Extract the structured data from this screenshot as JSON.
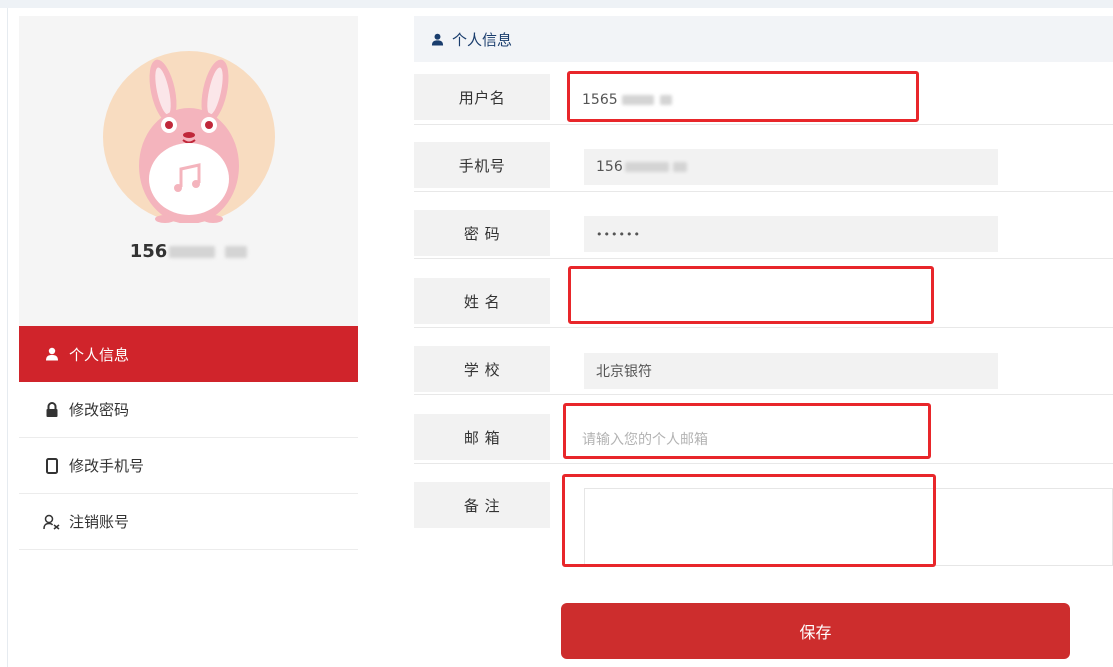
{
  "profile": {
    "username_visible": "156"
  },
  "sidebar": {
    "items": [
      {
        "label": "个人信息",
        "icon": "user-icon",
        "active": true
      },
      {
        "label": "修改密码",
        "icon": "lock-icon",
        "active": false
      },
      {
        "label": "修改手机号",
        "icon": "phone-icon",
        "active": false
      },
      {
        "label": "注销账号",
        "icon": "user-remove-icon",
        "active": false
      }
    ]
  },
  "main": {
    "header_title": "个人信息",
    "fields": {
      "username": {
        "label": "用户名",
        "value": "1565"
      },
      "phone": {
        "label": "手机号",
        "value": "156"
      },
      "password": {
        "label": "密 码",
        "value": "••••••"
      },
      "name": {
        "label": "姓 名",
        "value": ""
      },
      "school": {
        "label": "学 校",
        "value": "北京银符"
      },
      "email": {
        "label": "邮 箱",
        "placeholder": "请输入您的个人邮箱"
      },
      "notes": {
        "label": "备 注",
        "value": ""
      }
    },
    "save_label": "保存"
  },
  "colors": {
    "accent_red": "#d0242b",
    "save_button": "#cd2d2d",
    "highlight_box": "#e8262a",
    "header_text": "#1a3d6d"
  }
}
